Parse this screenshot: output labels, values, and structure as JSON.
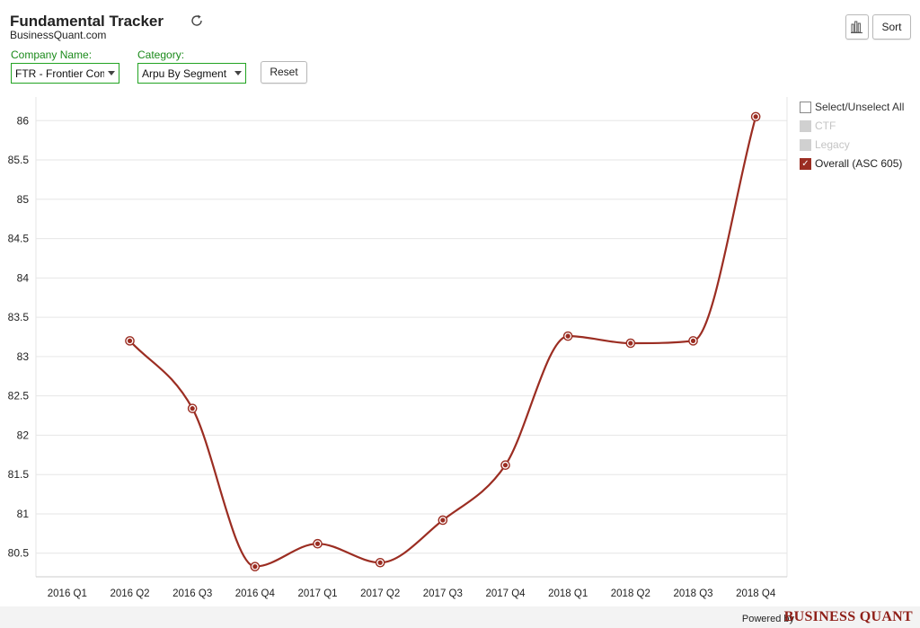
{
  "app": {
    "title": "Fundamental Tracker",
    "subtitle": "BusinessQuant.com",
    "refresh_icon": "refresh-icon"
  },
  "filters": {
    "company_label": "Company Name:",
    "company_value": "FTR - Frontier Communications",
    "category_label": "Category:",
    "category_value": "Arpu By Segment",
    "reset_label": "Reset"
  },
  "toolbar": {
    "chart_type_icon": "bar-chart-icon",
    "sort_label": "Sort"
  },
  "legend": {
    "select_all_label": "Select/Unselect All",
    "items": [
      {
        "label": "CTF",
        "checked": false
      },
      {
        "label": "Legacy",
        "checked": false
      },
      {
        "label": "Overall (ASC 605)",
        "checked": true
      }
    ]
  },
  "footer": {
    "powered_by": "Powered by",
    "brand": "BUSINESS QUANT"
  },
  "colors": {
    "series": "#9b2d22",
    "grid": "#e6e6e6",
    "axis_text": "#222222",
    "accent_green": "#22a322"
  },
  "chart_data": {
    "type": "line",
    "title": "",
    "xlabel": "",
    "ylabel": "",
    "categories": [
      "2016 Q1",
      "2016 Q2",
      "2016 Q3",
      "2016 Q4",
      "2017 Q1",
      "2017 Q2",
      "2017 Q3",
      "2017 Q4",
      "2018 Q1",
      "2018 Q2",
      "2018 Q3",
      "2018 Q4"
    ],
    "yticks": [
      "80.5",
      "81",
      "81.5",
      "82",
      "82.5",
      "83",
      "83.5",
      "84",
      "84.5",
      "85",
      "85.5",
      "86"
    ],
    "ylim": [
      80.2,
      86.3
    ],
    "smooth": true,
    "grid": true,
    "series": [
      {
        "name": "Overall (ASC 605)",
        "values": [
          null,
          83.2,
          82.34,
          80.33,
          80.62,
          80.38,
          80.92,
          81.62,
          83.26,
          83.17,
          83.2,
          86.05
        ]
      }
    ]
  }
}
